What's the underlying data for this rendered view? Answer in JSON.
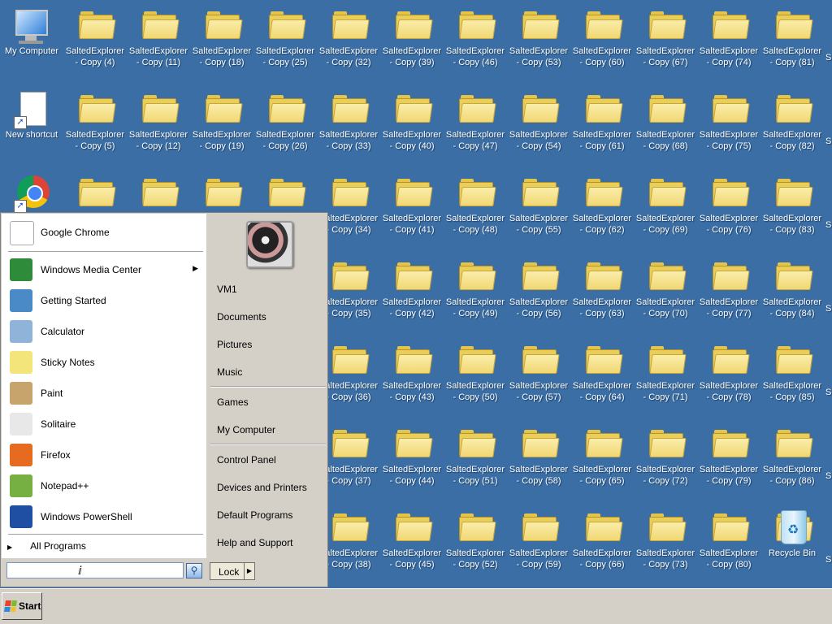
{
  "desktop": {
    "system_icons": [
      {
        "label": "My Computer",
        "icon": "computer-icon"
      },
      {
        "label": "New shortcut",
        "icon": "document-shortcut-icon"
      },
      {
        "label": "Google Chrome",
        "icon": "chrome-shortcut-icon"
      }
    ],
    "folder_prefix": "SaltedExplorer",
    "folders": [
      [
        "- Copy (4)",
        "- Copy (11)",
        "- Copy (18)",
        "- Copy (25)",
        "- Copy (32)",
        "- Copy (39)",
        "- Copy (46)",
        "- Copy (53)",
        "- Copy (60)",
        "- Copy (67)",
        "- Copy (74)",
        "- Copy (81)"
      ],
      [
        "- Copy (5)",
        "- Copy (12)",
        "- Copy (19)",
        "- Copy (26)",
        "- Copy (33)",
        "- Copy (40)",
        "- Copy (47)",
        "- Copy (54)",
        "- Copy (61)",
        "- Copy (68)",
        "- Copy (75)",
        "- Copy (82)"
      ],
      [
        "",
        "",
        "",
        "",
        "- Copy (34)",
        "- Copy (41)",
        "- Copy (48)",
        "- Copy (55)",
        "- Copy (62)",
        "- Copy (69)",
        "- Copy (76)",
        "- Copy (83)"
      ],
      [
        "",
        "",
        "",
        "",
        "- Copy (35)",
        "- Copy (42)",
        "- Copy (49)",
        "- Copy (56)",
        "- Copy (63)",
        "- Copy (70)",
        "- Copy (77)",
        "- Copy (84)"
      ],
      [
        "",
        "",
        "",
        "",
        "- Copy (36)",
        "- Copy (43)",
        "- Copy (50)",
        "- Copy (57)",
        "- Copy (64)",
        "- Copy (71)",
        "- Copy (78)",
        "- Copy (85)"
      ],
      [
        "",
        "",
        "",
        "",
        "- Copy (37)",
        "- Copy (44)",
        "- Copy (51)",
        "- Copy (58)",
        "- Copy (65)",
        "- Copy (72)",
        "- Copy (79)",
        "- Copy (86)"
      ],
      [
        "",
        "",
        "",
        "",
        "- Copy (38)",
        "- Copy (45)",
        "- Copy (52)",
        "- Copy (59)",
        "- Copy (66)",
        "- Copy (73)",
        "- Copy (80)",
        ""
      ]
    ],
    "recycle_bin": "Recycle Bin",
    "edge_partial_label": "S",
    "background_color": "#3a6ea5"
  },
  "start_menu": {
    "pinned": [
      {
        "label": "Google Chrome",
        "icon": "chrome-icon"
      }
    ],
    "programs": [
      {
        "label": "Windows Media Center",
        "icon": "media-center-icon",
        "has_submenu": true
      },
      {
        "label": "Getting Started",
        "icon": "getting-started-icon"
      },
      {
        "label": "Calculator",
        "icon": "calculator-icon"
      },
      {
        "label": "Sticky Notes",
        "icon": "sticky-notes-icon"
      },
      {
        "label": "Paint",
        "icon": "paint-icon"
      },
      {
        "label": "Solitaire",
        "icon": "solitaire-icon"
      },
      {
        "label": "Firefox",
        "icon": "firefox-icon"
      },
      {
        "label": "Notepad++",
        "icon": "notepadpp-icon"
      },
      {
        "label": "Windows PowerShell",
        "icon": "powershell-icon"
      }
    ],
    "all_programs": "All Programs",
    "right_items": [
      "VM1",
      "Documents",
      "Pictures",
      "Music",
      "Games",
      "My Computer",
      "Control Panel",
      "Devices and Printers",
      "Default Programs",
      "Help and Support"
    ],
    "search_value": "",
    "lock_label": "Lock"
  },
  "taskbar": {
    "start_label": "Start"
  }
}
